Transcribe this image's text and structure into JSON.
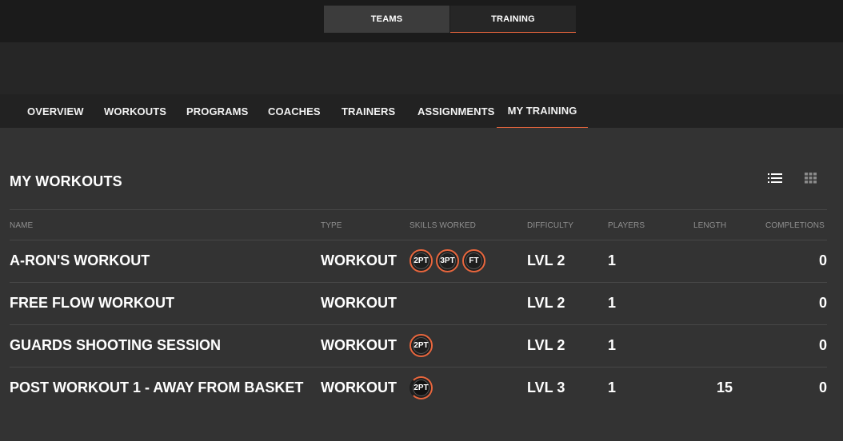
{
  "top_tabs": [
    {
      "label": "TEAMS"
    },
    {
      "label": "TRAINING"
    }
  ],
  "subnav": [
    {
      "label": "OVERVIEW"
    },
    {
      "label": "WORKOUTS"
    },
    {
      "label": "PROGRAMS"
    },
    {
      "label": "COACHES"
    },
    {
      "label": "TRAINERS"
    },
    {
      "label": "ASSIGNMENTS"
    },
    {
      "label": "MY TRAINING"
    }
  ],
  "active_subnav": "MY TRAINING",
  "section": {
    "title": "MY WORKOUTS",
    "view_icons": [
      "list-view-icon",
      "grid-view-icon"
    ]
  },
  "table": {
    "headers": {
      "name": "NAME",
      "type": "TYPE",
      "skills": "SKILLS WORKED",
      "difficulty": "DIFFICULTY",
      "players": "PLAYERS",
      "length": "LENGTH",
      "completions": "COMPLETIONS"
    },
    "rows": [
      {
        "name": "A-RON'S WORKOUT",
        "type": "WORKOUT",
        "skills": [
          "2PT",
          "3PT",
          "FT"
        ],
        "difficulty": "LVL 2",
        "players": "1",
        "length": "",
        "completions": "0"
      },
      {
        "name": "FREE FLOW WORKOUT",
        "type": "WORKOUT",
        "skills": [],
        "difficulty": "LVL 2",
        "players": "1",
        "length": "",
        "completions": "0"
      },
      {
        "name": "GUARDS SHOOTING SESSION",
        "type": "WORKOUT",
        "skills": [
          "2PT"
        ],
        "difficulty": "LVL 2",
        "players": "1",
        "length": "",
        "completions": "0"
      },
      {
        "name": "POST WORKOUT 1 - AWAY FROM BASKET",
        "type": "WORKOUT",
        "skills": [
          "2PT"
        ],
        "difficulty": "LVL 3",
        "players": "1",
        "length": "15",
        "completions": "0"
      }
    ]
  },
  "colors": {
    "accent": "#e8663d",
    "background": "#333333",
    "topbar": "#1b1b1b"
  }
}
